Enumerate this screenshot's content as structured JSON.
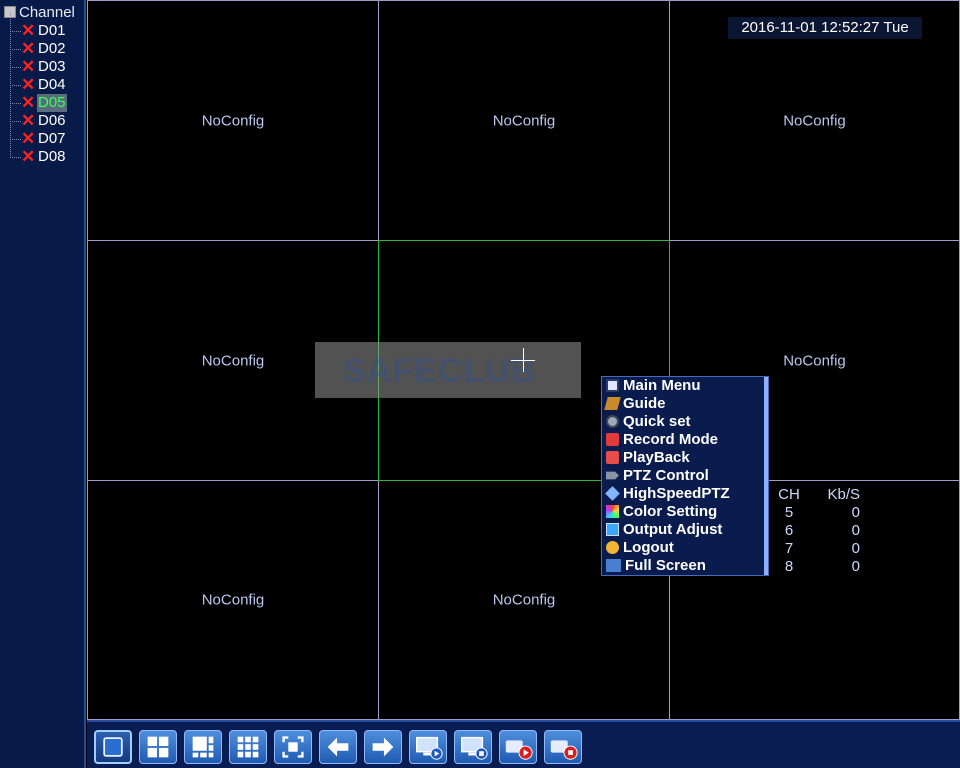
{
  "sidebar": {
    "root_label": "Channel",
    "channels": [
      {
        "label": "D01",
        "status_icon": "red-x-icon"
      },
      {
        "label": "D02",
        "status_icon": "red-x-icon"
      },
      {
        "label": "D03",
        "status_icon": "red-x-icon"
      },
      {
        "label": "D04",
        "status_icon": "red-x-icon"
      },
      {
        "label": "D05",
        "status_icon": "red-x-icon",
        "selected": true
      },
      {
        "label": "D06",
        "status_icon": "red-x-icon"
      },
      {
        "label": "D07",
        "status_icon": "red-x-icon"
      },
      {
        "label": "D08",
        "status_icon": "red-x-icon"
      }
    ]
  },
  "grid": {
    "cells": [
      {
        "label": "NoConfig"
      },
      {
        "label": "NoConfig"
      },
      {
        "label": "NoConfig"
      },
      {
        "label": "NoConfig"
      },
      {
        "label": ""
      },
      {
        "label": "NoConfig"
      },
      {
        "label": "NoConfig"
      },
      {
        "label": "NoConfig"
      },
      {
        "label": ""
      }
    ],
    "active_cell": 4
  },
  "datetime": "2016-11-01 12:52:27 Tue",
  "watermark": "SAFECLUB",
  "stats": {
    "headers": [
      "CH",
      "Kb/S"
    ],
    "rows": [
      {
        "ch": "5",
        "kbs": "0"
      },
      {
        "ch": "6",
        "kbs": "0"
      },
      {
        "ch": "7",
        "kbs": "0"
      },
      {
        "ch": "8",
        "kbs": "0"
      }
    ]
  },
  "context_menu": {
    "items": [
      {
        "label": "Main Menu",
        "icon": "main-menu-icon"
      },
      {
        "label": "Guide",
        "icon": "guide-icon"
      },
      {
        "label": "Quick set",
        "icon": "quick-set-icon"
      },
      {
        "label": "Record Mode",
        "icon": "record-mode-icon"
      },
      {
        "label": "PlayBack",
        "icon": "playback-icon"
      },
      {
        "label": "PTZ Control",
        "icon": "ptz-control-icon"
      },
      {
        "label": "HighSpeedPTZ",
        "icon": "highspeed-ptz-icon"
      },
      {
        "label": "Color Setting",
        "icon": "color-setting-icon"
      },
      {
        "label": "Output Adjust",
        "icon": "output-adjust-icon"
      },
      {
        "label": "Logout",
        "icon": "logout-icon"
      },
      {
        "label": "Full Screen",
        "icon": "full-screen-icon"
      }
    ]
  },
  "toolbar": {
    "buttons": [
      {
        "name": "single-view-button",
        "icon": "single-view-icon",
        "selected": true
      },
      {
        "name": "quad-view-button",
        "icon": "quad-view-icon"
      },
      {
        "name": "six-view-button",
        "icon": "six-view-icon"
      },
      {
        "name": "nine-view-button",
        "icon": "nine-view-icon"
      },
      {
        "name": "fullscreen-button",
        "icon": "fullscreen-icon"
      },
      {
        "name": "previous-button",
        "icon": "arrow-left-icon"
      },
      {
        "name": "next-button",
        "icon": "arrow-right-icon"
      },
      {
        "name": "start-tour-button",
        "icon": "tour-start-icon"
      },
      {
        "name": "stop-tour-button",
        "icon": "tour-stop-icon"
      },
      {
        "name": "start-record-button",
        "icon": "record-start-icon"
      },
      {
        "name": "stop-record-button",
        "icon": "record-stop-icon"
      }
    ]
  },
  "colors": {
    "sidebar_bg": "#071a48",
    "grid_line": "#a59bc8",
    "active_cell": "#2fb63f",
    "selected_channel_text": "#39ff5a",
    "error_x": "#ff2020",
    "menu_bg": "#0a1b4d"
  }
}
